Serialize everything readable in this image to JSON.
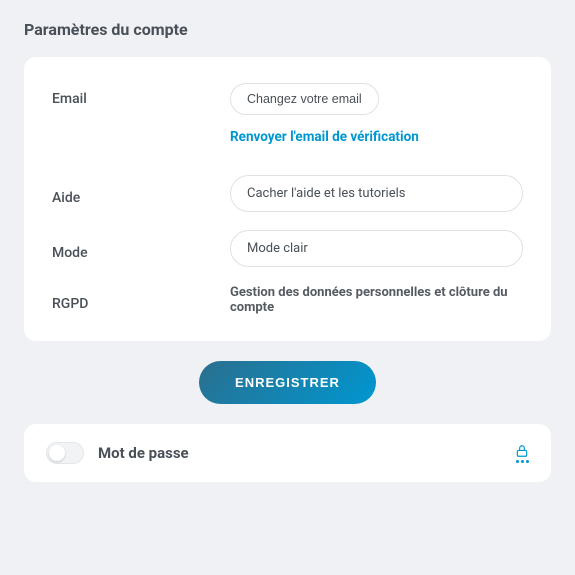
{
  "page": {
    "title": "Paramètres du compte"
  },
  "rows": {
    "email": {
      "label": "Email",
      "change_btn": "Changez votre email",
      "resend_link": "Renvoyer l'email de vérification"
    },
    "help": {
      "label": "Aide",
      "value": "Cacher l'aide et les tutoriels"
    },
    "mode": {
      "label": "Mode",
      "value": "Mode clair"
    },
    "rgpd": {
      "label": "RGPD",
      "text": "Gestion des données personnelles et clôture du compte"
    }
  },
  "actions": {
    "save": "ENREGISTRER"
  },
  "password": {
    "label": "Mot de passe"
  }
}
